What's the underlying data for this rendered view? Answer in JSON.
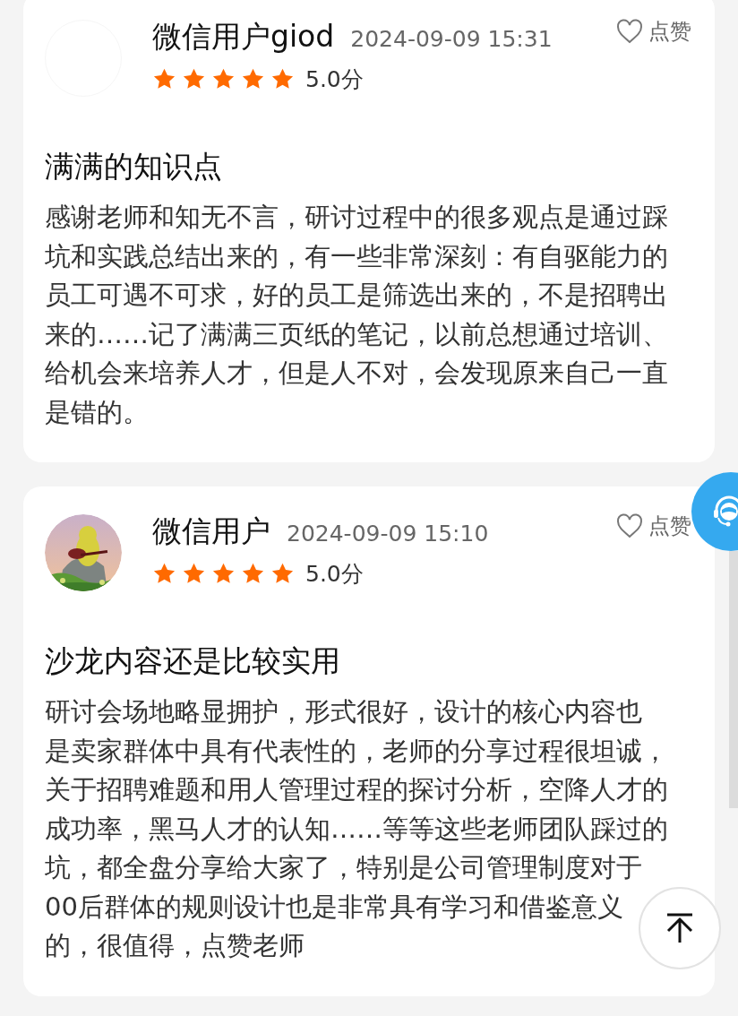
{
  "reviews": [
    {
      "avatar": {
        "kind": "blank"
      },
      "user": "微信用户giod",
      "time": "2024-09-09 15:31",
      "stars": 5,
      "score": "5.0分",
      "like": {
        "label": "点赞",
        "liked": false
      },
      "title": "满满的知识点",
      "body_lines": [
        "感谢老师和知无不言，研讨过程中的很多观点是通过踩",
        "坑和实践总结出来的，有一些非常深刻：有自驱能力的",
        "员工可遇不可求，好的员工是筛选出来的，不是招聘出",
        "来的……记了满满三页纸的笔记，以前总想通过培训、",
        "给机会来培养人才，但是人不对，会发现原来自己一直",
        "是错的。"
      ]
    },
    {
      "user": "微信用户",
      "time": "2024-09-09 15:10",
      "stars": 5,
      "score": "5.0分",
      "like": {
        "label": "点赞",
        "liked": false
      },
      "title": "沙龙内容还是比较实用",
      "body_lines": [
        "研讨会场地略显拥护，形式很好，设计的核心内容也",
        "是卖家群体中具有代表性的，老师的分享过程很坦诚，",
        "关于招聘难题和用人管理过程的探讨分析，空降人才的",
        "成功率，黑马人才的认知……等等这些老师团队踩过的",
        "坑，都全盘分享给大家了，特别是公司管理制度对于",
        "00后群体的规则设计也是非常具有学习和借鉴意义",
        "的，很值得，点赞老师"
      ]
    }
  ]
}
